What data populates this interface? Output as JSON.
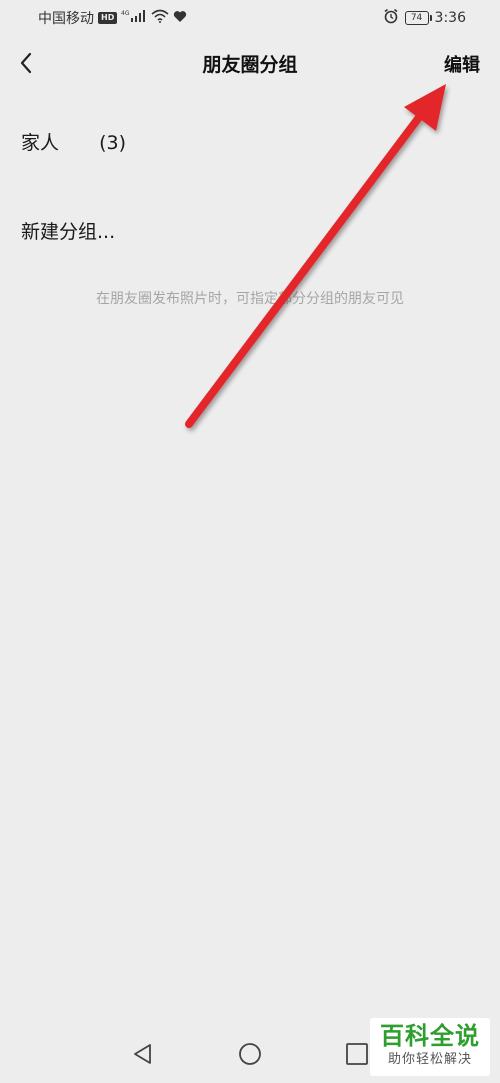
{
  "status_bar": {
    "carrier": "中国移动",
    "hd_badge": "HD",
    "network": "4G",
    "battery": "74",
    "time": "3:36"
  },
  "header": {
    "title": "朋友圈分组",
    "edit_label": "编辑"
  },
  "groups": [
    {
      "name": "家人",
      "count": "(3)"
    }
  ],
  "new_group_label": "新建分组...",
  "hint": "在朋友圈发布照片时，可指定部分分组的朋友可见",
  "annotation": {
    "color": "#e3262b"
  },
  "watermark": {
    "title": "百科全说",
    "subtitle": "助你轻松解决"
  },
  "icons": {
    "back": "chevron-left-icon",
    "nav_back": "triangle-back-icon",
    "nav_home": "circle-home-icon",
    "nav_recents": "square-recents-icon"
  }
}
